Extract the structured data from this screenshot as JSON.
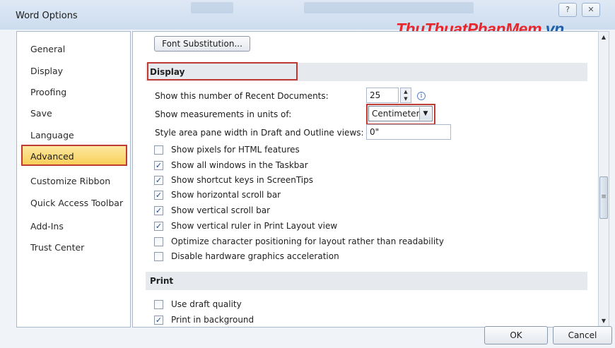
{
  "window": {
    "title": "Word Options",
    "help_glyph": "?",
    "close_glyph": "✕"
  },
  "watermark": {
    "part1": "Thu",
    "part2": "Thuat",
    "part3": "PhanMem",
    "part4": ".vn"
  },
  "nav": {
    "items": [
      {
        "label": "General"
      },
      {
        "label": "Display"
      },
      {
        "label": "Proofing"
      },
      {
        "label": "Save"
      },
      {
        "label": "Language"
      },
      {
        "label": "Advanced",
        "selected": true
      },
      {
        "label": "Customize Ribbon"
      },
      {
        "label": "Quick Access Toolbar"
      },
      {
        "label": "Add-Ins"
      },
      {
        "label": "Trust Center"
      }
    ]
  },
  "content": {
    "font_substitution_label": "Font Substitution...",
    "display_section": {
      "title": "Display",
      "recent_docs_label": "Show this number of Recent Documents:",
      "recent_docs_value": "25",
      "measurement_label": "Show measurements in units of:",
      "measurement_value": "Centimeters",
      "style_area_label": "Style area pane width in Draft and Outline views:",
      "style_area_value": "0\"",
      "checkboxes": [
        {
          "label": "Show pixels for HTML features",
          "checked": false
        },
        {
          "label": "Show all windows in the Taskbar",
          "checked": true
        },
        {
          "label": "Show shortcut keys in ScreenTips",
          "checked": true
        },
        {
          "label": "Show horizontal scroll bar",
          "checked": true
        },
        {
          "label": "Show vertical scroll bar",
          "checked": true
        },
        {
          "label": "Show vertical ruler in Print Layout view",
          "checked": true
        },
        {
          "label": "Optimize character positioning for layout rather than readability",
          "checked": false
        },
        {
          "label": "Disable hardware graphics acceleration",
          "checked": false
        }
      ]
    },
    "print_section": {
      "title": "Print",
      "checkboxes": [
        {
          "label": "Use draft quality",
          "checked": false
        },
        {
          "label": "Print in background",
          "checked": true
        }
      ]
    }
  },
  "footer": {
    "ok_label": "OK",
    "cancel_label": "Cancel"
  },
  "colors": {
    "highlight_border": "#c03a34",
    "selected_bg": "#f8cf5a",
    "watermark_red": "#e8262b",
    "watermark_blue": "#1f5fa8"
  }
}
